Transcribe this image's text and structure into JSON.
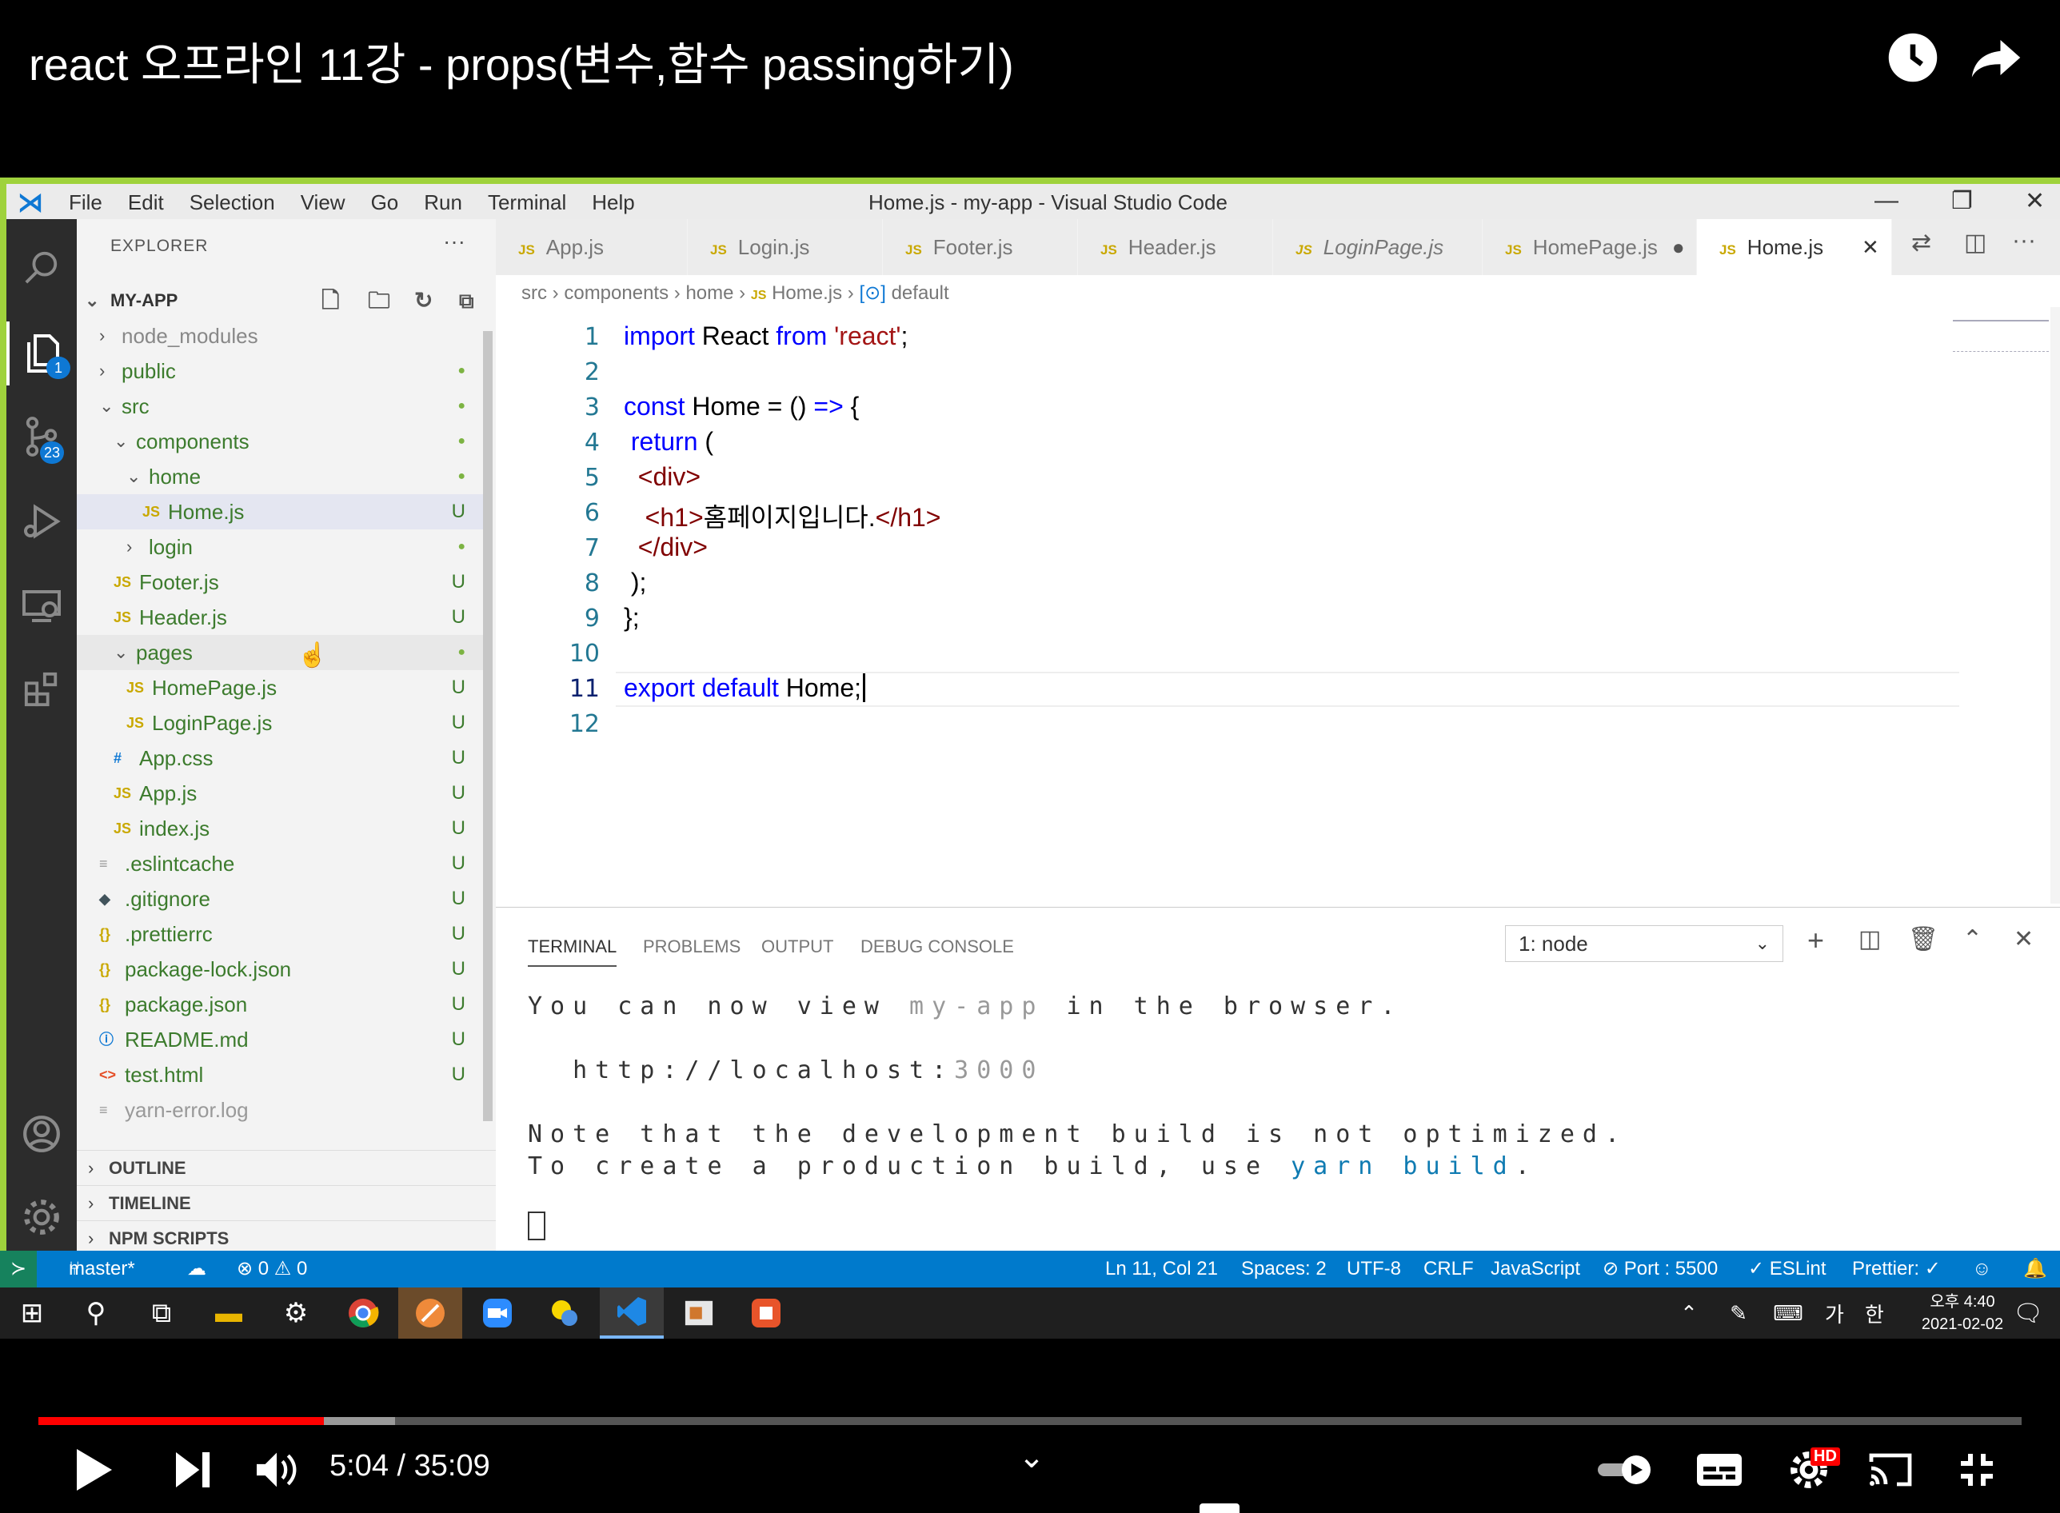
{
  "video": {
    "title": "react 오프라인 11강 - props(변수,함수 passing하기)",
    "time_display": "5:04 / 35:09",
    "progress": 0.144,
    "buffered": 0.18,
    "hd_badge": "HD"
  },
  "vscode": {
    "menu": [
      "File",
      "Edit",
      "Selection",
      "View",
      "Go",
      "Run",
      "Terminal",
      "Help"
    ],
    "window_title": "Home.js - my-app - Visual Studio Code",
    "explorer_header": "EXPLORER",
    "explorer_more": "···",
    "project": "MY-APP",
    "activity_badges": {
      "explorer": "1",
      "scm": "23"
    },
    "tree": [
      {
        "label": "node_modules",
        "icon": "",
        "decoration": ""
      },
      {
        "label": "public",
        "icon": "",
        "decoration": "●"
      },
      {
        "label": "src",
        "icon": "",
        "decoration": "●"
      },
      {
        "label": "components",
        "icon": "",
        "decoration": "●"
      },
      {
        "label": "home",
        "icon": "",
        "decoration": "●"
      },
      {
        "label": "Home.js",
        "icon": "JS",
        "decoration": "U"
      },
      {
        "label": "login",
        "icon": "",
        "decoration": "●"
      },
      {
        "label": "Footer.js",
        "icon": "JS",
        "decoration": "U"
      },
      {
        "label": "Header.js",
        "icon": "JS",
        "decoration": "U"
      },
      {
        "label": "pages",
        "icon": "",
        "decoration": "●"
      },
      {
        "label": "HomePage.js",
        "icon": "JS",
        "decoration": "U"
      },
      {
        "label": "LoginPage.js",
        "icon": "JS",
        "decoration": "U"
      },
      {
        "label": "App.css",
        "icon": "#",
        "decoration": "U"
      },
      {
        "label": "App.js",
        "icon": "JS",
        "decoration": "U"
      },
      {
        "label": "index.js",
        "icon": "JS",
        "decoration": "U"
      },
      {
        "label": ".eslintcache",
        "icon": "≡",
        "decoration": "U"
      },
      {
        "label": ".gitignore",
        "icon": "◆",
        "decoration": "U"
      },
      {
        "label": ".prettierrc",
        "icon": "{}",
        "decoration": "U"
      },
      {
        "label": "package-lock.json",
        "icon": "{}",
        "decoration": "U"
      },
      {
        "label": "package.json",
        "icon": "{}",
        "decoration": "U"
      },
      {
        "label": "README.md",
        "icon": "ⓘ",
        "decoration": "U"
      },
      {
        "label": "test.html",
        "icon": "<>",
        "decoration": "U"
      },
      {
        "label": "yarn-error.log",
        "icon": "≡",
        "decoration": ""
      }
    ],
    "sections": [
      "OUTLINE",
      "TIMELINE",
      "NPM SCRIPTS"
    ],
    "tabs": [
      {
        "label": "App.js",
        "icon": "JS"
      },
      {
        "label": "Login.js",
        "icon": "JS"
      },
      {
        "label": "Footer.js",
        "icon": "JS"
      },
      {
        "label": "Header.js",
        "icon": "JS"
      },
      {
        "label": "LoginPage.js",
        "icon": "JS"
      },
      {
        "label": "HomePage.js",
        "icon": "JS"
      },
      {
        "label": "Home.js",
        "icon": "JS"
      }
    ],
    "breadcrumb": [
      "src",
      "components",
      "home",
      "Home.js",
      "default"
    ],
    "line_numbers": [
      "1",
      "2",
      "3",
      "4",
      "5",
      "6",
      "7",
      "8",
      "9",
      "10",
      "11",
      "12"
    ],
    "code": {
      "l1a": "import",
      "l1b": " React ",
      "l1c": "from",
      "l1d": " 'react'",
      "l1e": ";",
      "l3a": "const",
      "l3b": " Home = () ",
      "l3c": "=>",
      "l3d": " {",
      "l4a": " return",
      "l4b": " (",
      "l5": "  <div>",
      "l6a": "   <h1>",
      "l6b": "홈페이지입니다.",
      "l6c": "</h1>",
      "l7": "  </div>",
      "l8": " );",
      "l9": "};",
      "l11a": "export default",
      "l11b": " Home;"
    },
    "panel_tabs": [
      "TERMINAL",
      "PROBLEMS",
      "OUTPUT",
      "DEBUG CONSOLE"
    ],
    "terminal_select": "1: node",
    "terminal": {
      "t1a": "You can now view ",
      "t1b": "my-app",
      "t1c": " in the browser.",
      "t2a": "  http://localhost:",
      "t2b": "3000",
      "t3": "Note that the development build is not optimized.",
      "t4a": "To create a production build, use ",
      "t4b": "yarn build",
      "t4c": "."
    },
    "status": {
      "branch": "master*",
      "errors": "⊗ 0 ⚠ 0",
      "position": "Ln 11, Col 21",
      "spaces": "Spaces: 2",
      "encoding": "UTF-8",
      "eol": "CRLF",
      "language": "JavaScript",
      "port": "⊘ Port : 5500",
      "eslint": "✓ ESLint",
      "prettier": "Prettier: ✓"
    }
  },
  "taskbar": {
    "ime1": "가",
    "ime2": "한",
    "clock_time": "오후 4:40",
    "clock_date": "2021-02-02"
  },
  "colors": {
    "accent": "#007acc",
    "progress": "#ff0000",
    "vscode_green": "#9fd23c"
  }
}
